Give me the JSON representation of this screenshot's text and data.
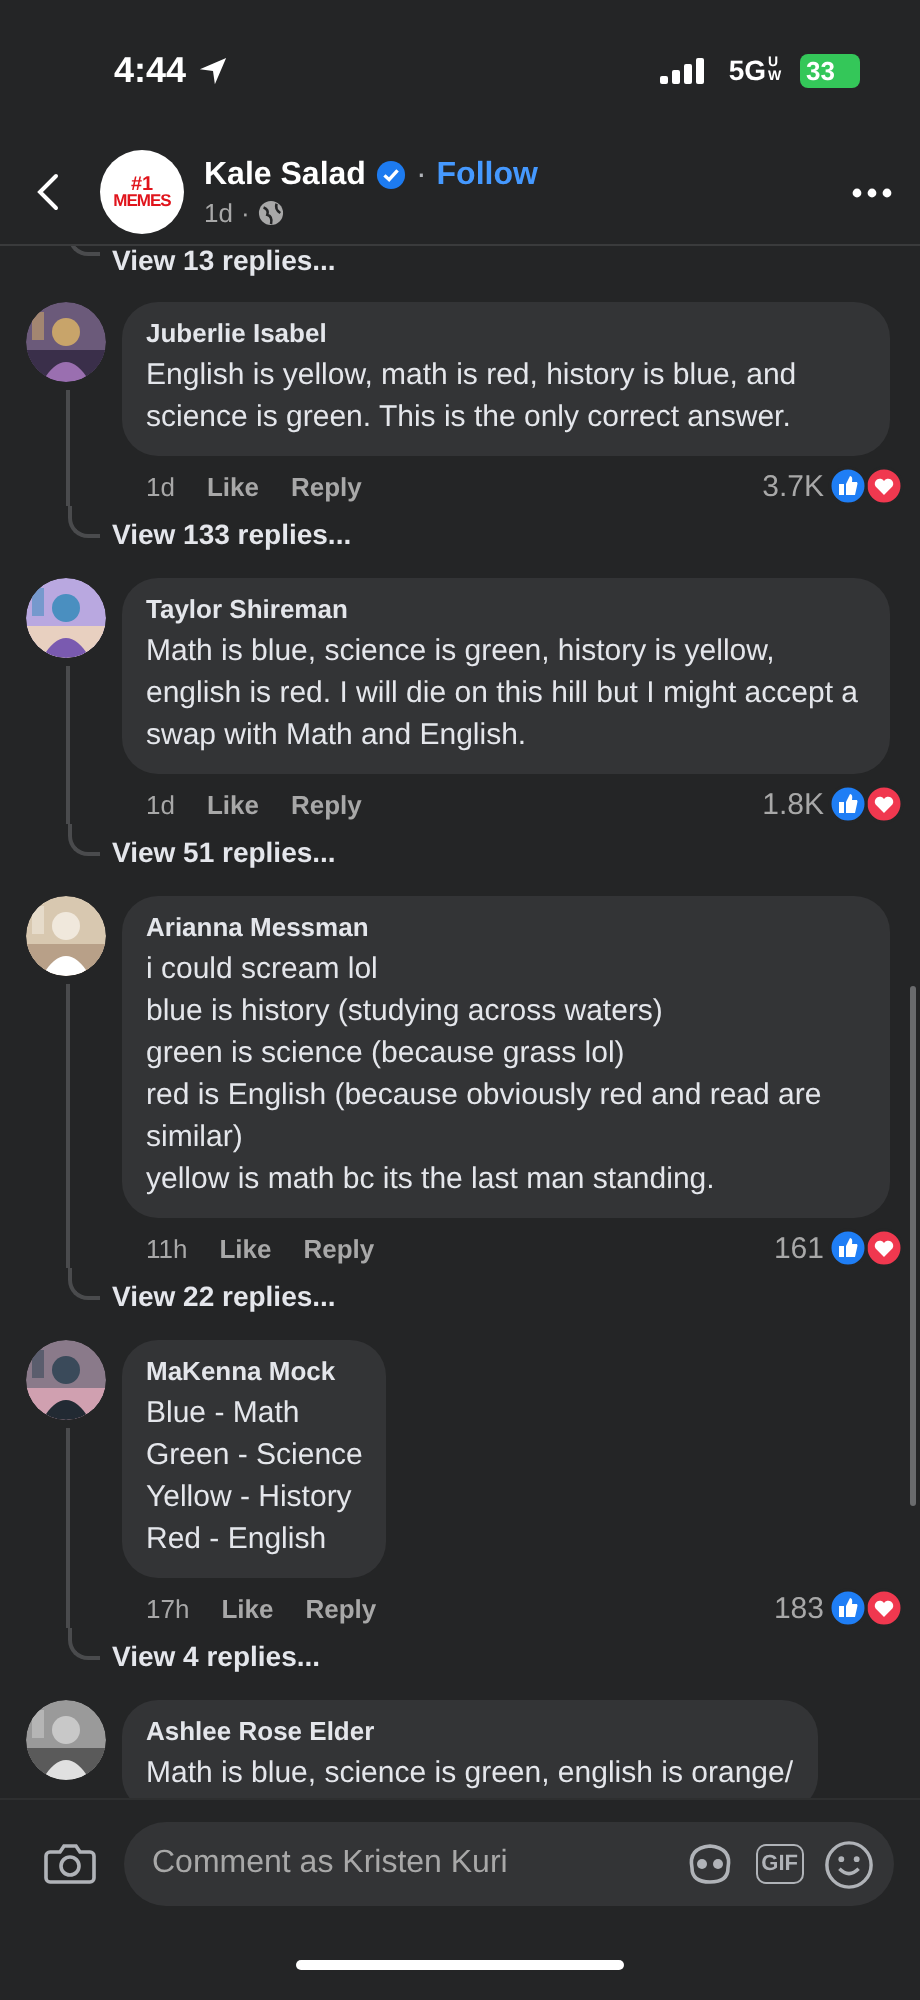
{
  "status_bar": {
    "time": "4:44",
    "network": "5G",
    "network_sub": "UW",
    "battery": "33"
  },
  "header": {
    "logo_lines": [
      "#1",
      "MEMES"
    ],
    "page_name": "Kale Salad",
    "separator": "·",
    "follow": "Follow",
    "age": "1d",
    "age_separator": "·"
  },
  "top_replies": "View 13 replies...",
  "comments": [
    {
      "author": "Juberlie Isabel",
      "text": "English is yellow, math is red, history is blue, and science is green. This is the only correct answer.",
      "age": "1d",
      "like": "Like",
      "reply": "Reply",
      "reactions": "3.7K",
      "view_replies": "View 133 replies..."
    },
    {
      "author": "Taylor Shireman",
      "text": "Math is blue, science is green, history is yellow, english is red. I will die on this hill but I might accept a swap with Math and English.",
      "age": "1d",
      "like": "Like",
      "reply": "Reply",
      "reactions": "1.8K",
      "view_replies": "View 51 replies..."
    },
    {
      "author": "Arianna Messman",
      "text": "i could scream lol\nblue is history (studying across waters)\ngreen is science (because grass lol)\nred is English (because obviously red and read are similar)\nyellow is math bc its the last man standing.",
      "age": "11h",
      "like": "Like",
      "reply": "Reply",
      "reactions": "161",
      "view_replies": "View 22 replies..."
    },
    {
      "author": "MaKenna Mock",
      "text": "Blue - Math\nGreen - Science\nYellow - History\nRed - English",
      "age": "17h",
      "like": "Like",
      "reply": "Reply",
      "reactions": "183",
      "view_replies": "View 4 replies..."
    },
    {
      "author": "Ashlee Rose Elder",
      "text": "Math is blue, science is green, english is orange/"
    }
  ],
  "composer": {
    "placeholder": "Comment as Kristen Kuri",
    "gif": "GIF"
  }
}
